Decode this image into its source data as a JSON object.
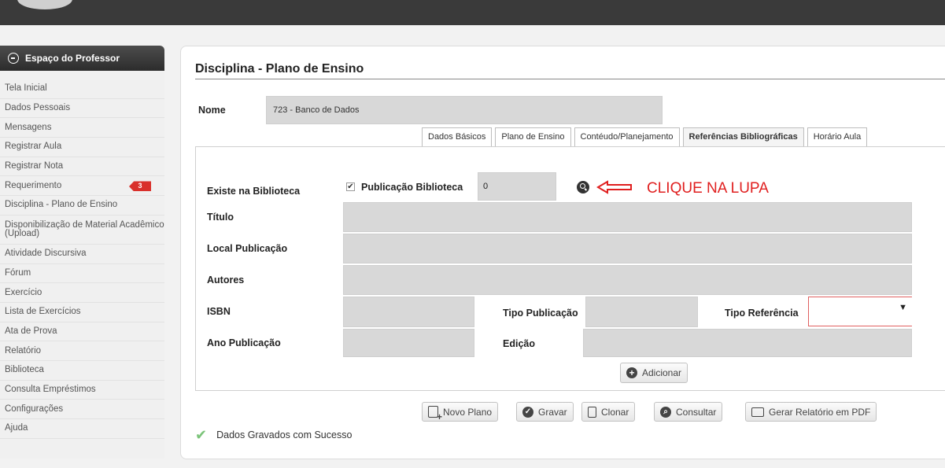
{
  "sidebar": {
    "title": "Espaço do Professor",
    "items": [
      {
        "label": "Tela Inicial"
      },
      {
        "label": "Dados Pessoais"
      },
      {
        "label": "Mensagens"
      },
      {
        "label": "Registrar Aula"
      },
      {
        "label": "Registrar Nota"
      },
      {
        "label": "Requerimento",
        "badge": "3"
      },
      {
        "label": "Disciplina - Plano de Ensino"
      },
      {
        "label": "Disponibilização de Material Acadêmico (Upload)"
      },
      {
        "label": "Atividade Discursiva"
      },
      {
        "label": "Fórum"
      },
      {
        "label": "Exercício"
      },
      {
        "label": "Lista de Exercícios"
      },
      {
        "label": "Ata de Prova"
      },
      {
        "label": "Relatório"
      },
      {
        "label": "Biblioteca"
      },
      {
        "label": "Consulta Empréstimos"
      },
      {
        "label": "Configurações"
      },
      {
        "label": "Ajuda"
      }
    ]
  },
  "page": {
    "title": "Disciplina - Plano de Ensino",
    "nome_label": "Nome",
    "nome_value": "723 - Banco de Dados"
  },
  "tabs": [
    {
      "label": "Dados Básicos"
    },
    {
      "label": "Plano de Ensino"
    },
    {
      "label": "Contéudo/Planejamento"
    },
    {
      "label": "Referências Bibliográficas",
      "active": true
    },
    {
      "label": "Horário Aula"
    }
  ],
  "form": {
    "existe_label": "Existe na Biblioteca",
    "checkbox_label": "Publicação Biblioteca",
    "checkbox_checked": true,
    "publicacao_value": "0",
    "annotation": "CLIQUE NA LUPA",
    "titulo_label": "Título",
    "local_label": "Local Publicação",
    "autores_label": "Autores",
    "isbn_label": "ISBN",
    "tipo_publicacao_label": "Tipo Publicação",
    "tipo_referencia_label": "Tipo Referência",
    "ano_label": "Ano Publicação",
    "edicao_label": "Edição",
    "adicionar_label": "Adicionar"
  },
  "actions": {
    "novo_plano": "Novo Plano",
    "gravar": "Gravar",
    "clonar": "Clonar",
    "consultar": "Consultar",
    "gerar_pdf": "Gerar Relatório em PDF"
  },
  "status": {
    "message": "Dados Gravados com Sucesso"
  },
  "colors": {
    "annotation": "#e01f1f",
    "badge": "#d9302b",
    "success_check": "#7cc47a"
  }
}
